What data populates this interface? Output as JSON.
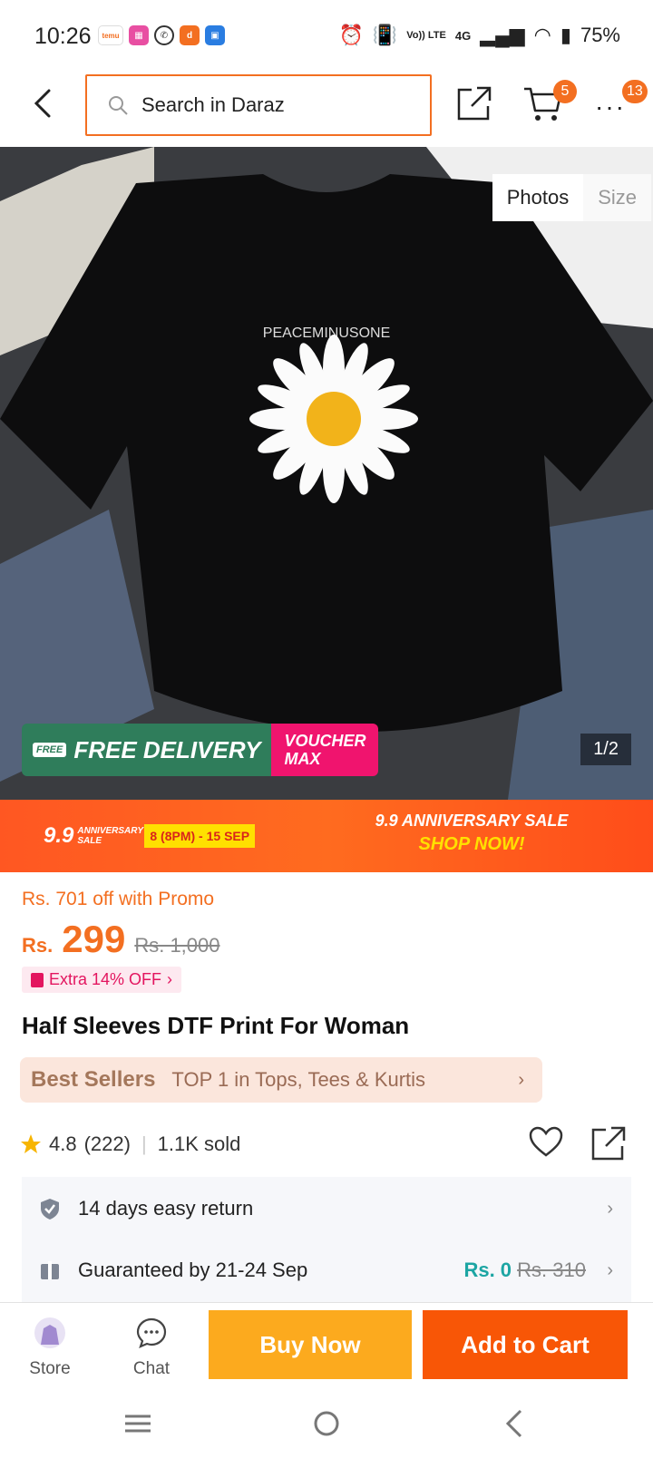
{
  "status": {
    "time": "10:26",
    "battery": "75%",
    "network": "4G",
    "volte": "Vo)) LTE",
    "notification_apps": [
      "temu-app-icon",
      "game-app-icon",
      "whatsapp-icon",
      "daraz-app-icon",
      "calendar-app-icon"
    ]
  },
  "header": {
    "search_placeholder": "Search in Daraz",
    "cart_count": "5",
    "more_count": "13"
  },
  "gallery": {
    "tabs": [
      "Photos",
      "Size"
    ],
    "counter": "1/2",
    "shirt_print_text": "PEACEMINUSONE",
    "free_delivery_small": "FREE",
    "free_delivery": "FREE DELIVERY",
    "voucher_line1": "VOUCHER",
    "voucher_line2": "MAX"
  },
  "banner": {
    "sale_number": "9.9",
    "sale_small": "ANNIVERSARY SALE",
    "dates": "8 (8PM) - 15 SEP",
    "headline": "9.9 ANNIVERSARY SALE",
    "cta": "SHOP NOW!"
  },
  "product": {
    "promo_line": "Rs. 701 off with Promo",
    "currency": "Rs.",
    "price": "299",
    "old_price": "Rs. 1,000",
    "extra_off": "Extra 14% OFF",
    "title": "Half Sleeves DTF Print For Woman",
    "bestseller_label": "Best Sellers",
    "bestseller_desc": "TOP 1 in Tops, Tees & Kurtis",
    "rating": "4.8",
    "reviews": "(222)",
    "sold": "1.1K sold"
  },
  "services": {
    "return_text": "14 days easy return",
    "delivery_text": "Guaranteed by 21-24 Sep",
    "delivery_price": "Rs. 0",
    "delivery_old_price": "Rs. 310"
  },
  "bottom": {
    "store": "Store",
    "chat": "Chat",
    "buy_now": "Buy Now",
    "add_to_cart": "Add to Cart"
  },
  "colors": {
    "brand_orange": "#f85606",
    "buy_yellow": "#fcaa1e",
    "free_green": "#2f7d5b",
    "voucher_pink": "#f0146e",
    "delivery_teal": "#1ca5a3"
  }
}
